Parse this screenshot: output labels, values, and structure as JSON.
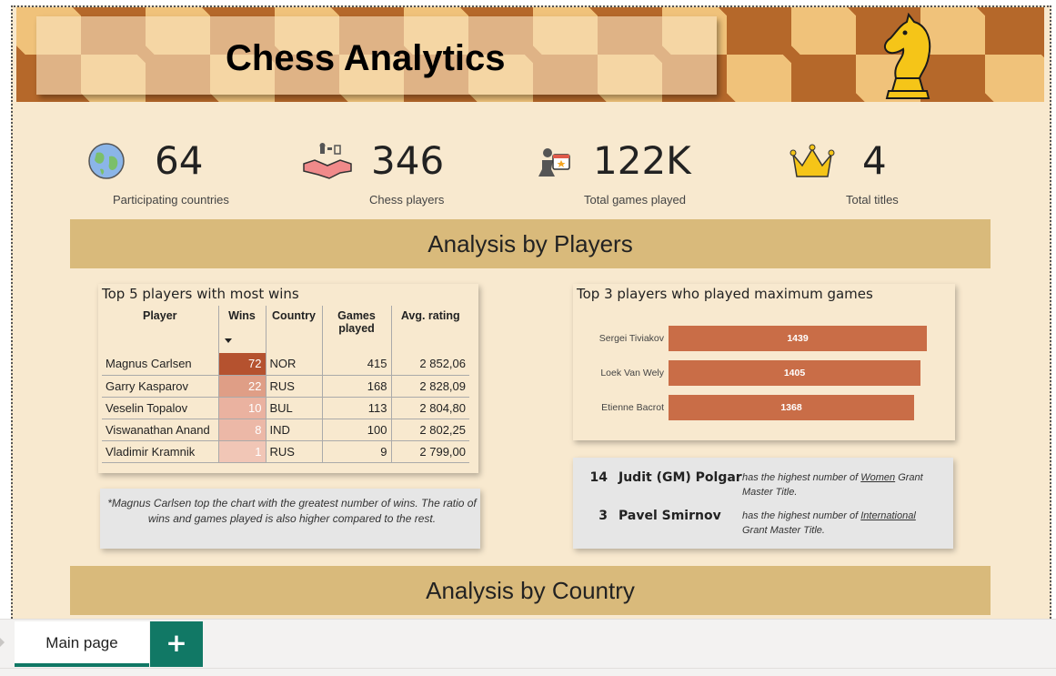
{
  "header": {
    "title": "Chess Analytics",
    "logo_icon": "knight-icon"
  },
  "kpis": [
    {
      "value": "64",
      "label": "Participating countries",
      "icon": "globe-icon"
    },
    {
      "value": "346",
      "label": "Chess players",
      "icon": "handshake-icon"
    },
    {
      "value": "122K",
      "label": "Total games played",
      "icon": "pawn-calendar-icon"
    },
    {
      "value": "4",
      "label": "Total titles",
      "icon": "crown-icon"
    }
  ],
  "sections": {
    "players": "Analysis by Players",
    "country": "Analysis by Country"
  },
  "top_wins": {
    "title": "Top 5 players with most wins",
    "columns": [
      "Player",
      "Wins",
      "Country",
      "Games played",
      "Avg. rating"
    ],
    "sort_icon": "sort-desc-icon",
    "rows": [
      {
        "player": "Magnus Carlsen",
        "wins": "72",
        "country": "NOR",
        "games": "415",
        "rating": "2 852,06",
        "shade": "#b5522f"
      },
      {
        "player": "Garry Kasparov",
        "wins": "22",
        "country": "RUS",
        "games": "168",
        "rating": "2 828,09",
        "shade": "#df9e86"
      },
      {
        "player": "Veselin Topalov",
        "wins": "10",
        "country": "BUL",
        "games": "113",
        "rating": "2 804,80",
        "shade": "#eab2a0"
      },
      {
        "player": "Viswanathan Anand",
        "wins": "8",
        "country": "IND",
        "games": "100",
        "rating": "2 802,25",
        "shade": "#ecb8a7"
      },
      {
        "player": "Vladimir Kramnik",
        "wins": "1",
        "country": "RUS",
        "games": "9",
        "rating": "2 799,00",
        "shade": "#f1c6b6"
      }
    ]
  },
  "note": "*Magnus Carlsen top the chart with the greatest number of wins. The ratio of wins and games played is also higher compared to the rest.",
  "top_games": {
    "title": "Top 3 players who played maximum games",
    "bar_color": "#c96d47"
  },
  "chart_data": {
    "type": "bar",
    "orientation": "horizontal",
    "title": "Top 3 players who played maximum games",
    "categories": [
      "Sergei Tiviakov",
      "Loek Van Wely",
      "Etienne Bacrot"
    ],
    "values": [
      1439,
      1405,
      1368
    ],
    "data_labels": [
      "1439",
      "1405",
      "1368"
    ]
  },
  "titles": [
    {
      "count": "14",
      "name": "Judit (GM) Polgar",
      "desc_pre": "has the highest number of ",
      "desc_link": "Women",
      "desc_post": " Grant Master Title."
    },
    {
      "count": "3",
      "name": "Pavel Smirnov",
      "desc_pre": "has the highest number of ",
      "desc_link": "International",
      "desc_post": " Grant Master Title."
    }
  ],
  "tabs": {
    "main": "Main page",
    "add": "+"
  },
  "colors": {
    "background": "#f8e9cf",
    "section": "#d9ba7b",
    "accent": "#117865",
    "bar": "#c96d47"
  }
}
